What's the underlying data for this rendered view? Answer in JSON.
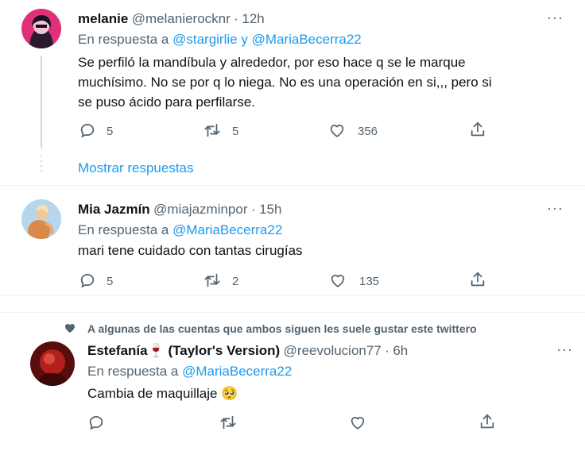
{
  "tweets": [
    {
      "name": "melanie",
      "handle": "@melanierocknr",
      "sep": "·",
      "time": "12h",
      "reply_prefix": "En respuesta a",
      "reply_to_1": "@stargirlie",
      "reply_and": "y",
      "reply_to_2": "@MariaBecerra22",
      "text": "Se perfiló la mandíbula y alrededor, por eso hace q se le marque muchísimo. No se por q lo niega. No es una operación en si,,, pero si se puso ácido para perfilarse.",
      "replies": "5",
      "retweets": "5",
      "likes": "356",
      "show_replies": "Mostrar respuestas"
    },
    {
      "name": "Mia Jazmín",
      "handle": "@miajazminpor",
      "sep": "·",
      "time": "15h",
      "reply_prefix": "En respuesta a",
      "reply_to": "@MariaBecerra22",
      "text": "mari tene cuidado con tantas cirugías",
      "replies": "5",
      "retweets": "2",
      "likes": "135"
    },
    {
      "social_context": "A algunas de las cuentas que ambos siguen les suele gustar este twittero",
      "name": "Estefanía🍷 (Taylor's Version)",
      "handle": "@reevolucion77",
      "sep": "·",
      "time": "6h",
      "reply_prefix": "En respuesta a",
      "reply_to": "@MariaBecerra22",
      "text": "Cambia de maquillaje 🥺",
      "replies": "",
      "retweets": "",
      "likes": ""
    }
  ],
  "more_glyph": "···",
  "colors": {
    "link": "#1d9bf0",
    "muted": "#536471",
    "text": "#0f1419"
  }
}
